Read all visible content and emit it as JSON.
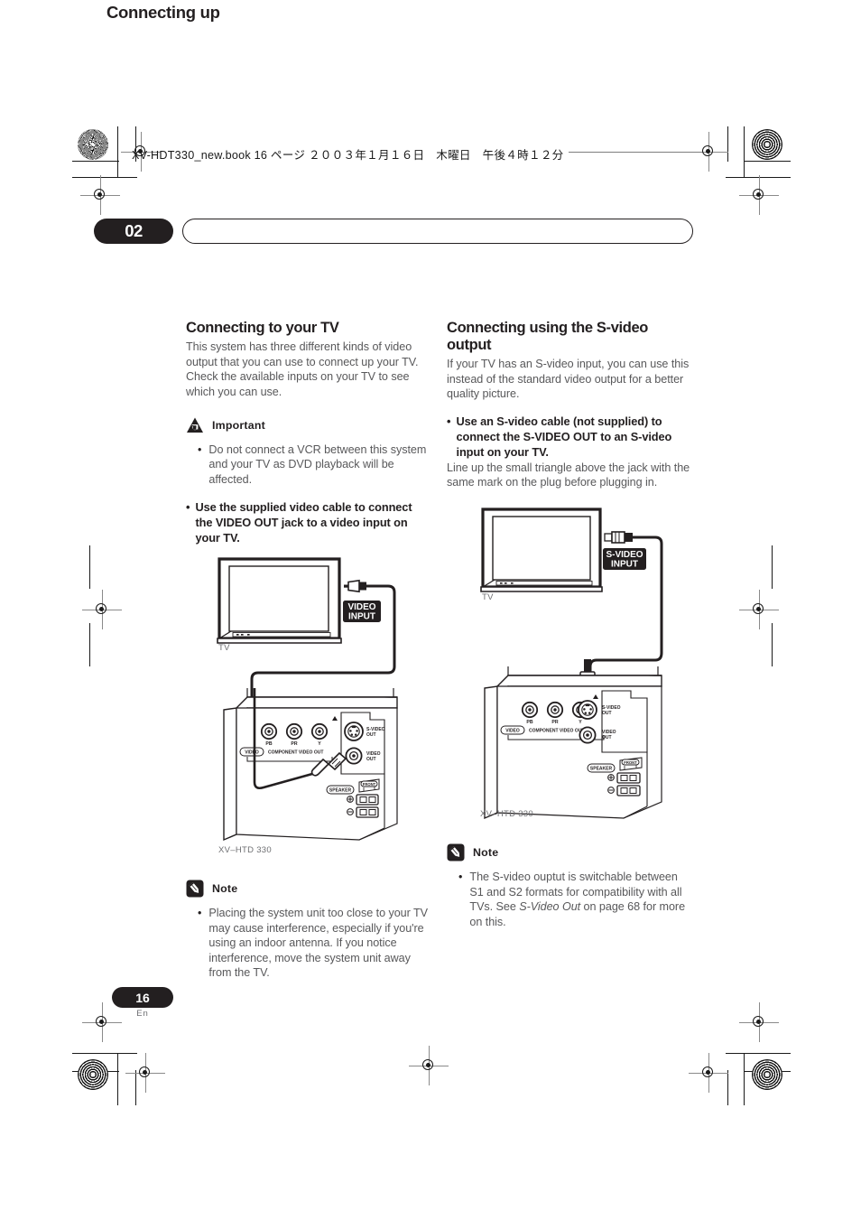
{
  "print_marks": {
    "starburst_icon": "registration-starburst",
    "target_icon": "registration-target"
  },
  "file_header": {
    "text": "XV-HDT330_new.book  16 ページ  ２００３年１月１６日　木曜日　午後４時１２分"
  },
  "chapter": {
    "number": "02",
    "title": "Connecting up"
  },
  "left_column": {
    "heading": "Connecting to your TV",
    "intro": "This system has three different kinds of video output that you can use to connect up your TV. Check the available inputs on your TV to see which you can use.",
    "important": {
      "icon": "important-triangle-icon",
      "label": "Important",
      "bullet_char": "•",
      "bullet_text": "Do not connect a VCR between this system and your TV as DVD playback will be affected."
    },
    "instruction": {
      "bullet_char": "•",
      "text": "Use the supplied video cable to connect the VIDEO OUT jack to a video input on your TV."
    },
    "diagram": {
      "tv_label": "TV",
      "input_badge": "VIDEO\nINPUT",
      "input_badge_line1": "VIDEO",
      "input_badge_line2": "INPUT",
      "unit_label": "XV–HTD 330",
      "rear_panel": {
        "video_badge": "VIDEO",
        "component_label": "COMPONENT VIDEO OUT",
        "jack_pb": "PB",
        "jack_pr": "PR",
        "jack_y": "Y",
        "svideo_out": "S-VIDEO\nOUT",
        "svideo_out_line1": "S-VIDEO",
        "svideo_out_line2": "OUT",
        "video_out": "VIDEO\nOUT",
        "video_out_line1": "VIDEO",
        "video_out_line2": "OUT",
        "speaker_badge": "SPEAKER",
        "front_label": "FRONT"
      }
    },
    "note": {
      "icon": "note-pencil-icon",
      "label": "Note",
      "bullet_char": "•",
      "bullet_text": "Placing the system unit too close to your TV may cause interference, especially if you're using an indoor antenna. If you notice interference, move the system unit away from the TV."
    }
  },
  "right_column": {
    "heading": "Connecting using the S-video output",
    "intro": "If your TV has an S-video input, you can use this instead of the standard video output for a better quality picture.",
    "instruction": {
      "bullet_char": "•",
      "text": "Use an S-video cable (not supplied) to connect the S-VIDEO OUT to an S-video input on your TV."
    },
    "instruction_body": "Line up the small triangle above the jack with the same mark on the plug before plugging in.",
    "diagram": {
      "tv_label": "TV",
      "input_badge_line1": "S-VIDEO",
      "input_badge_line2": "INPUT",
      "unit_label": "XV–HTD 330",
      "rear_panel": {
        "video_badge": "VIDEO",
        "component_label": "COMPONENT VIDEO OUT",
        "jack_pb": "PB",
        "jack_pr": "PR",
        "jack_y": "Y",
        "svideo_out_line1": "S-VIDEO",
        "svideo_out_line2": "OUT",
        "video_out_line1": "VIDEO",
        "video_out_line2": "OUT",
        "speaker_badge": "SPEAKER",
        "front_label": "FRONT"
      }
    },
    "note": {
      "icon": "note-pencil-icon",
      "label": "Note",
      "bullet_char": "•",
      "bullet_text_part1": "The S-video ouptut is switchable between S1 and S2 formats for compatibility with all TVs. See ",
      "bullet_italic": "S-Video Out",
      "bullet_text_part2": " on page 68 for more on this."
    }
  },
  "footer": {
    "page_number": "16",
    "language": "En"
  },
  "colors": {
    "ink": "#231f20",
    "body_text": "#58585a",
    "muted": "#6d6e71"
  }
}
